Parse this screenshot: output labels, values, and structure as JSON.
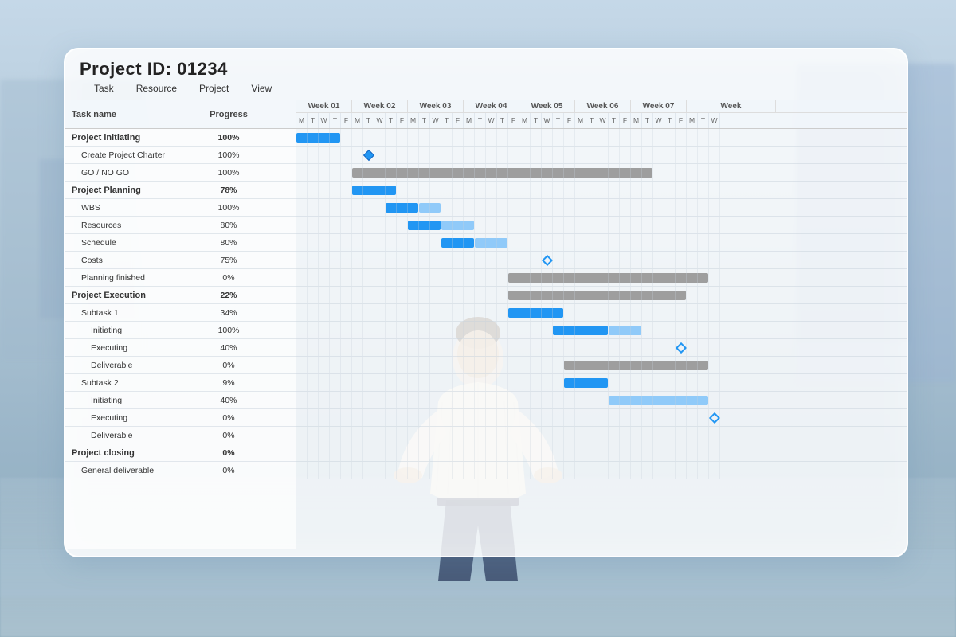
{
  "panel": {
    "project_id": "Project ID: 01234",
    "menu": [
      "Task",
      "Resource",
      "Project",
      "View"
    ]
  },
  "table": {
    "col_task": "Task name",
    "col_progress": "Progress",
    "weeks": [
      "Week 01",
      "Week 02",
      "Week 03",
      "Week 04",
      "Week 05",
      "Week 06",
      "Week 07",
      "Week"
    ],
    "days": [
      "M",
      "T",
      "W",
      "T",
      "F",
      "M",
      "T",
      "W",
      "T",
      "F",
      "M",
      "T",
      "W",
      "T",
      "F",
      "M",
      "T",
      "W",
      "T",
      "F",
      "M",
      "T",
      "W",
      "T",
      "F",
      "M",
      "T",
      "W",
      "T",
      "F",
      "M",
      "T",
      "W",
      "T",
      "F",
      "M",
      "T",
      "W"
    ],
    "rows": [
      {
        "name": "Project initiating",
        "progress": "100%",
        "level": "group"
      },
      {
        "name": "Create Project Charter",
        "progress": "100%",
        "level": "sub"
      },
      {
        "name": "GO / NO GO",
        "progress": "100%",
        "level": "sub"
      },
      {
        "name": "Project Planning",
        "progress": "78%",
        "level": "group"
      },
      {
        "name": "WBS",
        "progress": "100%",
        "level": "sub"
      },
      {
        "name": "Resources",
        "progress": "80%",
        "level": "sub"
      },
      {
        "name": "Schedule",
        "progress": "80%",
        "level": "sub"
      },
      {
        "name": "Costs",
        "progress": "75%",
        "level": "sub"
      },
      {
        "name": "Planning finished",
        "progress": "0%",
        "level": "sub"
      },
      {
        "name": "Project Execution",
        "progress": "22%",
        "level": "group"
      },
      {
        "name": "Subtask 1",
        "progress": "34%",
        "level": "sub"
      },
      {
        "name": "Initiating",
        "progress": "100%",
        "level": "subsub"
      },
      {
        "name": "Executing",
        "progress": "40%",
        "level": "subsub"
      },
      {
        "name": "Deliverable",
        "progress": "0%",
        "level": "subsub"
      },
      {
        "name": "Subtask 2",
        "progress": "9%",
        "level": "sub"
      },
      {
        "name": "Initiating",
        "progress": "40%",
        "level": "subsub"
      },
      {
        "name": "Executing",
        "progress": "0%",
        "level": "subsub"
      },
      {
        "name": "Deliverable",
        "progress": "0%",
        "level": "subsub"
      },
      {
        "name": "Project closing",
        "progress": "0%",
        "level": "group"
      },
      {
        "name": "General deliverable",
        "progress": "0%",
        "level": "sub"
      }
    ]
  }
}
